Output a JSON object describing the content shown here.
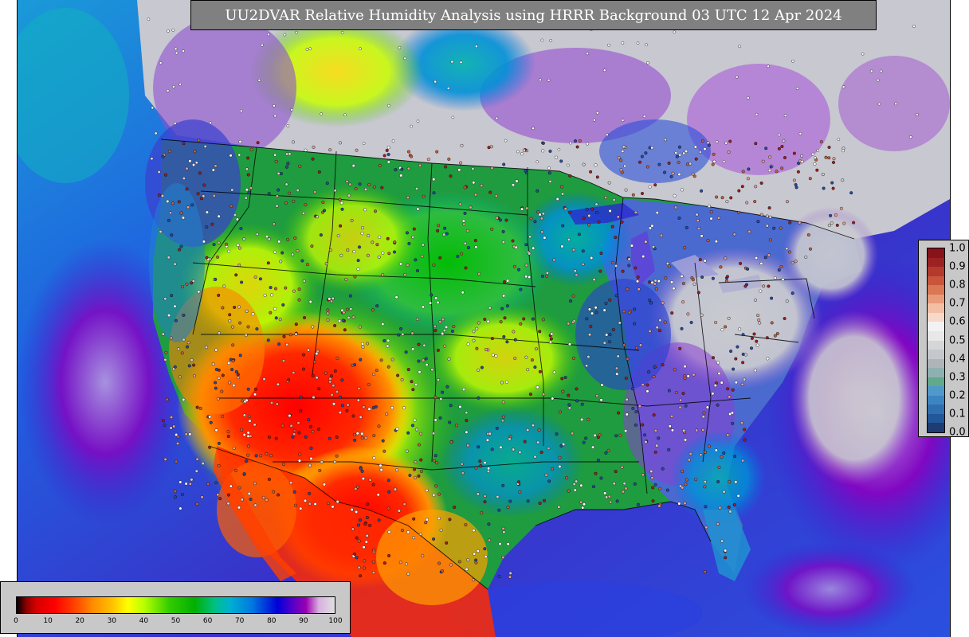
{
  "map": {
    "title": "UU2DVAR Relative Humidity Analysis using HRRR Background 03 UTC 12 Apr 2024"
  },
  "rh_colorbar": {
    "ticks": [
      "0",
      "10",
      "20",
      "30",
      "40",
      "50",
      "60",
      "70",
      "80",
      "90",
      "100"
    ]
  },
  "fraction_colorbar": {
    "ticks": [
      "1.0",
      "0.9",
      "0.8",
      "0.7",
      "0.6",
      "0.5",
      "0.4",
      "0.3",
      "0.2",
      "0.1",
      "0.0"
    ],
    "colors": [
      "#1f3c72",
      "#22579a",
      "#2f6fb0",
      "#3d85c2",
      "#4f9acb",
      "#62a88a",
      "#8fb0b0",
      "#aeb4b8",
      "#c4c8cc",
      "#d6d6d6",
      "#e8e8e8",
      "#f2f2f2",
      "#f7d9c9",
      "#f2bfa5",
      "#e89b7a",
      "#d87854",
      "#c8563c",
      "#b33a2c",
      "#9c2222",
      "#87141a"
    ]
  },
  "colors": {
    "ocean": "#2a6cd8",
    "canada": "#d2d2d2",
    "frame": "#000000"
  }
}
